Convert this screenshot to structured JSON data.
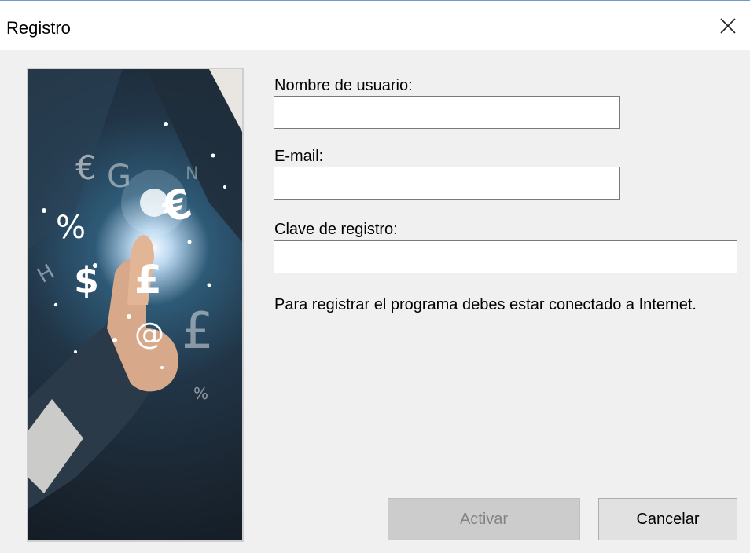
{
  "window": {
    "title": "Registro",
    "close_glyph": "close-icon"
  },
  "image": {
    "description_icon": "currency-touch-illustration",
    "symbols": [
      "€",
      "G",
      "%",
      "$",
      "£",
      "@",
      "€",
      "£",
      "%",
      "H"
    ]
  },
  "form": {
    "username": {
      "label": "Nombre de usuario:",
      "value": ""
    },
    "email": {
      "label": "E-mail:",
      "value": ""
    },
    "key": {
      "label": "Clave de registro:",
      "value": ""
    }
  },
  "info_text": "Para registrar el programa debes estar conectado a Internet.",
  "buttons": {
    "activate": "Activar",
    "cancel": "Cancelar"
  },
  "colors": {
    "window_bg": "#f0f0f0",
    "titlebar_bg": "#ffffff",
    "disabled_text": "#838383"
  }
}
